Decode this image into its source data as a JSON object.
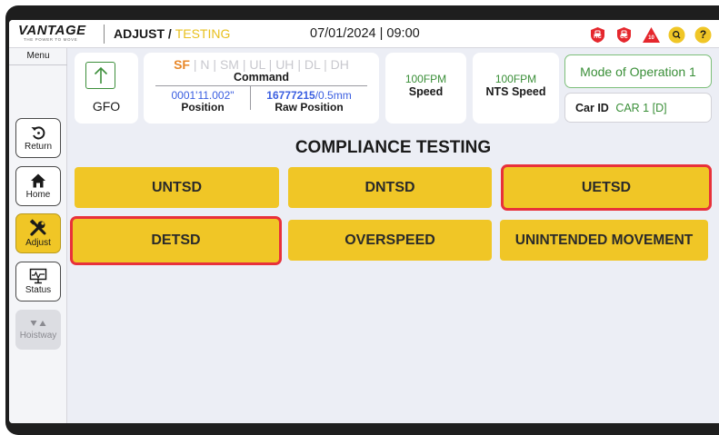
{
  "brand": {
    "name": "VANTAGE",
    "tagline": "THE POWER TO MOVE"
  },
  "header": {
    "crumb_section": "ADJUST",
    "crumb_separator": "/",
    "crumb_current": "TESTING",
    "date": "07/01/2024",
    "divider": "|",
    "time": "09:00",
    "status_icons": [
      {
        "name": "hc-lock-icon",
        "label": "HC",
        "color": "#e5272d"
      },
      {
        "name": "cc-lock-icon",
        "label": "CC",
        "color": "#e5272d"
      },
      {
        "name": "fault-count-icon",
        "label": "10",
        "color": "#e5272d"
      },
      {
        "name": "search-icon",
        "label": "",
        "color": "#f0c626"
      },
      {
        "name": "help-icon",
        "label": "?",
        "color": "#f0c626"
      }
    ]
  },
  "sidebar": {
    "menu_label": "Menu",
    "items": [
      {
        "label": "Return",
        "icon": "return-icon",
        "active": false,
        "disabled": false
      },
      {
        "label": "Home",
        "icon": "home-icon",
        "active": false,
        "disabled": false
      },
      {
        "label": "Adjust",
        "icon": "tools-icon",
        "active": true,
        "disabled": false
      },
      {
        "label": "Status",
        "icon": "monitor-icon",
        "active": false,
        "disabled": false
      },
      {
        "label": "Hoistway",
        "icon": "hoistway-icon",
        "active": false,
        "disabled": true
      }
    ]
  },
  "info": {
    "gfo_label": "GFO",
    "flags": [
      {
        "text": "SF",
        "on": true
      },
      {
        "text": "N",
        "on": false
      },
      {
        "text": "SM",
        "on": false
      },
      {
        "text": "UL",
        "on": false
      },
      {
        "text": "UH",
        "on": false
      },
      {
        "text": "DL",
        "on": false
      },
      {
        "text": "DH",
        "on": false
      }
    ],
    "flag_separator": "|",
    "command_title": "Command",
    "position_value": "0001'11.002\"",
    "position_label": "Position",
    "raw_position_value": "16777215",
    "raw_position_unit": "/0.5mm",
    "raw_position_label": "Raw Position",
    "speed_value": "100FPM",
    "speed_label": "Speed",
    "nts_speed_value": "100FPM",
    "nts_speed_label": "NTS Speed",
    "mode": "Mode of Operation 1",
    "car_id_label": "Car ID",
    "car_id_value": "CAR 1 [D]"
  },
  "testing": {
    "title": "COMPLIANCE TESTING",
    "buttons": [
      {
        "label": "UNTSD",
        "selected": false
      },
      {
        "label": "DNTSD",
        "selected": false
      },
      {
        "label": "UETSD",
        "selected": true
      },
      {
        "label": "DETSD",
        "selected": true
      },
      {
        "label": "OVERSPEED",
        "selected": false
      },
      {
        "label": "UNINTENDED MOVEMENT",
        "selected": false
      }
    ]
  },
  "colors": {
    "accent_yellow": "#f0c626",
    "status_green": "#3a8f38",
    "value_blue": "#3a5ee0",
    "flag_orange": "#e8882a",
    "highlight_red": "#e8313a"
  }
}
